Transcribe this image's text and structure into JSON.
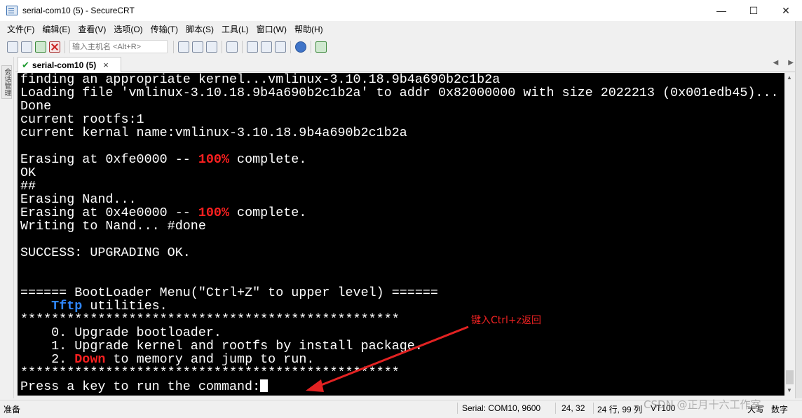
{
  "window": {
    "title": "serial-com10 (5) - SecureCRT",
    "controls": {
      "minimize": "—",
      "maximize": "☐",
      "close": "✕"
    }
  },
  "menu": [
    "文件(F)",
    "编辑(E)",
    "查看(V)",
    "选项(O)",
    "传输(T)",
    "脚本(S)",
    "工具(L)",
    "窗口(W)",
    "帮助(H)"
  ],
  "toolbar": {
    "host_placeholder": "输入主机名 <Alt+R>"
  },
  "session_dock": {
    "label": "会话管理"
  },
  "tab": {
    "label": "serial-com10 (5)",
    "close": "×"
  },
  "tab_nav": {
    "prev": "◀",
    "next": "▶"
  },
  "terminal": {
    "lines": [
      {
        "segments": [
          {
            "text": "finding an appropriate kernel...vmlinux-3.10.18.9b4a690b2c1b2a"
          }
        ]
      },
      {
        "segments": [
          {
            "text": "Loading file 'vmlinux-3.10.18.9b4a690b2c1b2a' to addr 0x82000000 with size 2022213 (0x001edb45)..."
          }
        ]
      },
      {
        "segments": [
          {
            "text": "Done"
          }
        ]
      },
      {
        "segments": [
          {
            "text": "current rootfs:1"
          }
        ]
      },
      {
        "segments": [
          {
            "text": "current kernal name:vmlinux-3.10.18.9b4a690b2c1b2a"
          }
        ]
      },
      {
        "segments": [
          {
            "text": ""
          }
        ]
      },
      {
        "segments": [
          {
            "text": "Erasing at 0xfe0000 -- "
          },
          {
            "text": "100%",
            "style": "red"
          },
          {
            "text": " complete."
          }
        ]
      },
      {
        "segments": [
          {
            "text": "OK"
          }
        ]
      },
      {
        "segments": [
          {
            "text": "##"
          }
        ]
      },
      {
        "segments": [
          {
            "text": "Erasing Nand..."
          }
        ]
      },
      {
        "segments": [
          {
            "text": "Erasing at 0x4e0000 -- "
          },
          {
            "text": "100%",
            "style": "red"
          },
          {
            "text": " complete."
          }
        ]
      },
      {
        "segments": [
          {
            "text": "Writing to Nand... #done"
          }
        ]
      },
      {
        "segments": [
          {
            "text": ""
          }
        ]
      },
      {
        "segments": [
          {
            "text": "SUCCESS: UPGRADING OK."
          }
        ]
      },
      {
        "segments": [
          {
            "text": ""
          }
        ]
      },
      {
        "segments": [
          {
            "text": ""
          }
        ]
      },
      {
        "segments": [
          {
            "text": "====== BootLoader Menu(\"Ctrl+Z\" to upper level) ======"
          }
        ]
      },
      {
        "segments": [
          {
            "text": "    "
          },
          {
            "text": "Tftp",
            "style": "blue"
          },
          {
            "text": " utilities."
          }
        ]
      },
      {
        "segments": [
          {
            "text": "*************************************************"
          }
        ]
      },
      {
        "segments": [
          {
            "text": "    0. Upgrade bootloader."
          }
        ]
      },
      {
        "segments": [
          {
            "text": "    1. Upgrade kernel and rootfs by install package."
          }
        ]
      },
      {
        "segments": [
          {
            "text": "    2. "
          },
          {
            "text": "Down",
            "style": "red"
          },
          {
            "text": " to memory and jump to run."
          }
        ]
      },
      {
        "segments": [
          {
            "text": "*************************************************"
          }
        ]
      },
      {
        "segments": [
          {
            "text": "Press a key to run the command:"
          }
        ],
        "cursor": true
      }
    ]
  },
  "annotation": {
    "text": "键入Ctrl+z返回",
    "color": "#e22222"
  },
  "statusbar": {
    "ready": "准备",
    "connection": "Serial: COM10, 9600",
    "cursor_pos": "24,  32",
    "size": "24 行, 99 列",
    "emulation": "VT100",
    "caps": "大写",
    "num": "数字"
  },
  "watermark": "CSDN @正月十六工作室"
}
